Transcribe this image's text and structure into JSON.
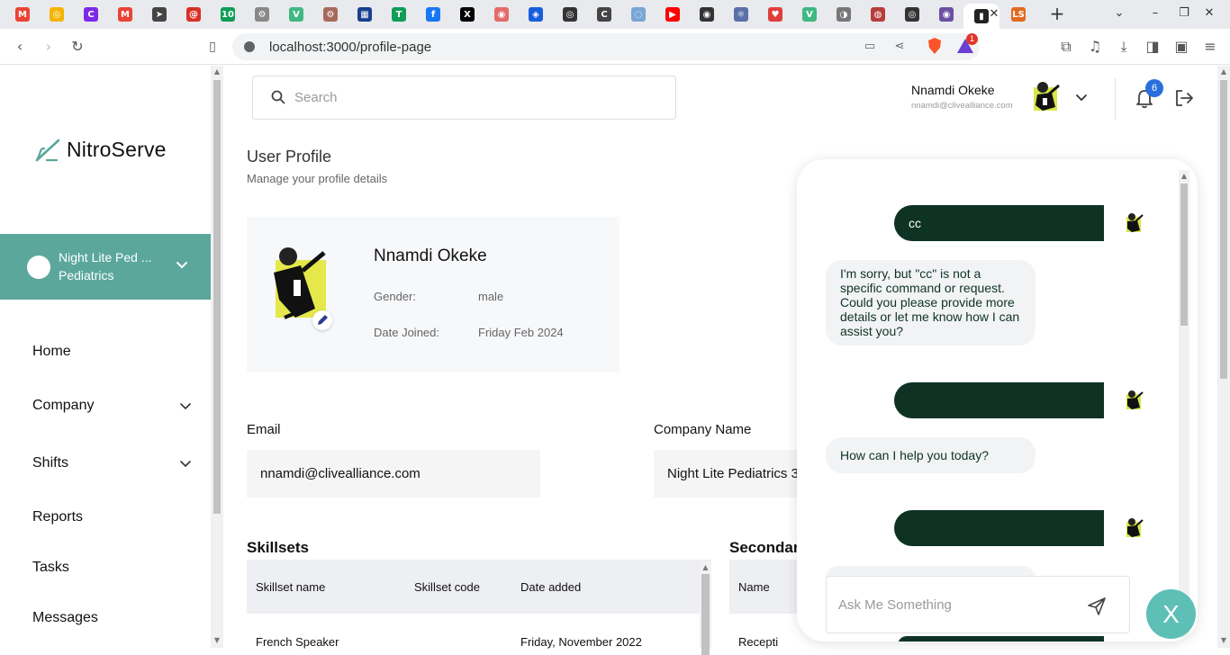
{
  "browser": {
    "url": "localhost:3000/profile-page",
    "tabs": [
      {
        "icon": "gmail-icon",
        "color": "#ea4335",
        "glyph": "M"
      },
      {
        "icon": "chrome-extension-icon",
        "color": "#f4b400",
        "glyph": "◎"
      },
      {
        "icon": "canva-icon",
        "color": "#7d2ae8",
        "glyph": "C"
      },
      {
        "icon": "gmail-icon",
        "color": "#ea4335",
        "glyph": "M"
      },
      {
        "icon": "telegram-icon",
        "color": "#444444",
        "glyph": "➤"
      },
      {
        "icon": "mail-icon",
        "color": "#d93025",
        "glyph": "@"
      },
      {
        "icon": "green-app-icon",
        "color": "#0f9d58",
        "glyph": "10"
      },
      {
        "icon": "settings-icon",
        "color": "#888888",
        "glyph": "⚙"
      },
      {
        "icon": "vue-icon",
        "color": "#41b883",
        "glyph": "V"
      },
      {
        "icon": "settings-icon",
        "color": "#a86b5b",
        "glyph": "⚙"
      },
      {
        "icon": "calendar-icon",
        "color": "#1a3f8f",
        "glyph": "▦"
      },
      {
        "icon": "sheets-icon",
        "color": "#0f9d58",
        "glyph": "T"
      },
      {
        "icon": "facebook-icon",
        "color": "#1877f2",
        "glyph": "f"
      },
      {
        "icon": "x-twitter-icon",
        "color": "#000000",
        "glyph": "X"
      },
      {
        "icon": "record-icon",
        "color": "#e56a6a",
        "glyph": "◉"
      },
      {
        "icon": "bitwarden-icon",
        "color": "#175ddc",
        "glyph": "◈"
      },
      {
        "icon": "github-icon",
        "color": "#333333",
        "glyph": "◎"
      },
      {
        "icon": "refresh-icon",
        "color": "#444444",
        "glyph": "C"
      },
      {
        "icon": "globe-icon",
        "color": "#7aa6d6",
        "glyph": "◌"
      },
      {
        "icon": "youtube-icon",
        "color": "#ff0000",
        "glyph": "▶"
      },
      {
        "icon": "circle-icon",
        "color": "#333333",
        "glyph": "◉"
      },
      {
        "icon": "react-icon",
        "color": "#5b6fa8",
        "glyph": "⚛"
      },
      {
        "icon": "heart-icon",
        "color": "#e03e3e",
        "glyph": "♥"
      },
      {
        "icon": "vue-icon",
        "color": "#41b883",
        "glyph": "V"
      },
      {
        "icon": "cloud-icon",
        "color": "#777777",
        "glyph": "◑"
      },
      {
        "icon": "brand-icon",
        "color": "#b73c3c",
        "glyph": "◍"
      },
      {
        "icon": "github-icon",
        "color": "#333333",
        "glyph": "◎"
      },
      {
        "icon": "purple-app-icon",
        "color": "#6a4fa3",
        "glyph": "◉"
      },
      {
        "icon": "active-page-icon",
        "color": "#222222",
        "glyph": "▮"
      },
      {
        "icon": "ls-icon",
        "color": "#e06b1f",
        "glyph": "LS"
      }
    ],
    "notifications_count": "1"
  },
  "brand": {
    "name": "NitroServe",
    "accent": "#5ba79c",
    "dark_green": "#0e3324"
  },
  "sidebar": {
    "org_name": "Night Lite Ped ...",
    "org_dept": "Pediatrics",
    "items": [
      {
        "label": "Home",
        "has_children": false
      },
      {
        "label": "Company",
        "has_children": true
      },
      {
        "label": "Shifts",
        "has_children": true
      },
      {
        "label": "Reports",
        "has_children": false
      },
      {
        "label": "Tasks",
        "has_children": false
      },
      {
        "label": "Messages",
        "has_children": false
      }
    ]
  },
  "header": {
    "search_placeholder": "Search",
    "user_name": "Nnamdi Okeke",
    "user_email": "nnamdi@clivealliance.com",
    "notification_count": "6"
  },
  "profile": {
    "title": "User Profile",
    "subtitle": "Manage your profile details",
    "name": "Nnamdi Okeke",
    "gender_label": "Gender:",
    "gender": "male",
    "joined_label": "Date Joined:",
    "joined": "Friday Feb 2024",
    "email_label": "Email",
    "email": "nnamdi@clivealliance.com",
    "company_label": "Company Name",
    "company": "Night Lite Pediatrics 3"
  },
  "skillsets": {
    "title": "Skillsets",
    "columns": [
      "Skillset name",
      "Skillset code",
      "Date added"
    ],
    "rows": [
      [
        "French Speaker",
        "",
        "Friday, November 2022"
      ]
    ]
  },
  "secondary": {
    "title": "Secondar",
    "columns": [
      "Name"
    ],
    "rows": [
      [
        "Recepti"
      ]
    ]
  },
  "chat": {
    "messages": [
      {
        "from": "user",
        "text": "cc"
      },
      {
        "from": "bot",
        "text": "I'm sorry, but \"cc\" is not a specific command or request. Could you please provide more details or let me know how I can assist you?"
      },
      {
        "from": "user",
        "text": ""
      },
      {
        "from": "bot",
        "text": "How can I help you today?"
      },
      {
        "from": "user",
        "text": ""
      }
    ],
    "input_placeholder": "Ask Me Something",
    "close_label": "X"
  }
}
